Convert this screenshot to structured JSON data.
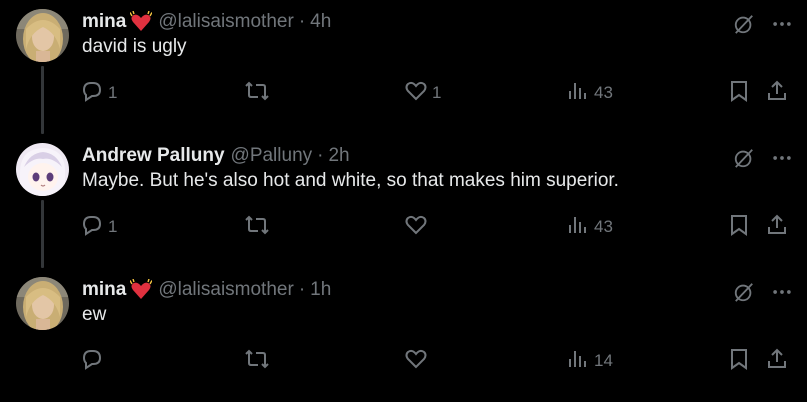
{
  "tweets": [
    {
      "display_name": "mina",
      "handle": "@lalisaismother",
      "time": "4h",
      "text": "david is ugly",
      "has_emoji": true,
      "avatar": "blonde-woman-avatar",
      "replies": "1",
      "retweets": "",
      "likes": "1",
      "views": "43"
    },
    {
      "display_name": "Andrew Palluny",
      "handle": "@Palluny",
      "time": "2h",
      "text": "Maybe. But he's also hot and white, so that makes him superior.",
      "has_emoji": false,
      "avatar": "anime-girl-avatar",
      "replies": "1",
      "retweets": "",
      "likes": "",
      "views": "43"
    },
    {
      "display_name": "mina",
      "handle": "@lalisaismother",
      "time": "1h",
      "text": "ew",
      "has_emoji": true,
      "avatar": "blonde-woman-avatar",
      "replies": "",
      "retweets": "",
      "likes": "",
      "views": "14"
    }
  ],
  "separator": "·",
  "icons": {
    "emoji": "heart-with-ribbon-icon",
    "grok": "grok-icon",
    "more": "more-icon",
    "reply": "reply-icon",
    "retweet": "retweet-icon",
    "like": "heart-icon",
    "views": "views-icon",
    "bookmark": "bookmark-icon",
    "share": "share-icon"
  },
  "colors": {
    "background": "#000000",
    "text": "#e7e9ea",
    "muted": "#71767b",
    "thread_line": "#333639",
    "emoji_red": "#e0313f"
  }
}
